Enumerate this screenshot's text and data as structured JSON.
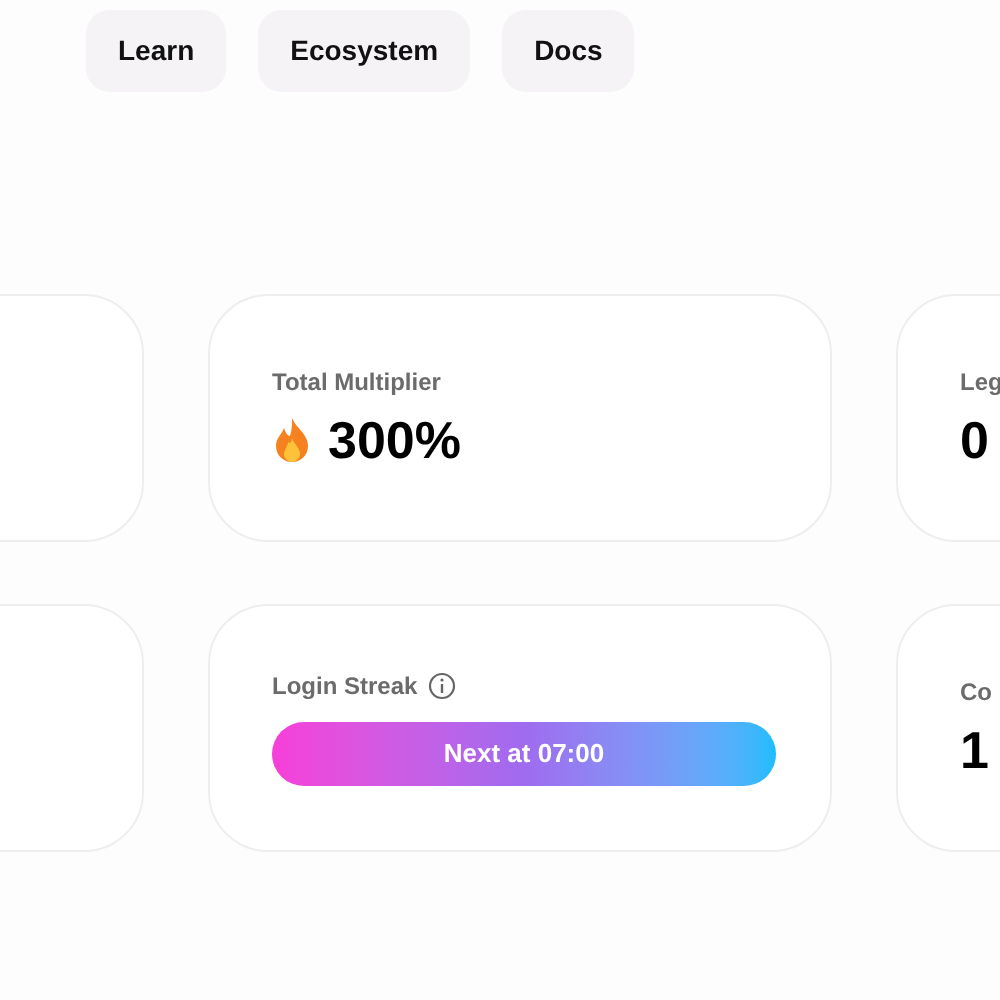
{
  "nav": [
    {
      "label": "Learn"
    },
    {
      "label": "Ecosystem"
    },
    {
      "label": "Docs"
    }
  ],
  "card_rows": [
    [
      {
        "kind": "empty"
      },
      {
        "kind": "stat",
        "label": "Total Multiplier",
        "value": "300%",
        "flame": true
      },
      {
        "kind": "stat",
        "label": "Leg",
        "value": "0",
        "flame": false
      }
    ],
    [
      {
        "kind": "empty"
      },
      {
        "kind": "streak",
        "label": "Login Streak",
        "button": "Next at 07:00"
      },
      {
        "kind": "stat",
        "label": "Co",
        "value": "1",
        "flame": false
      }
    ]
  ]
}
